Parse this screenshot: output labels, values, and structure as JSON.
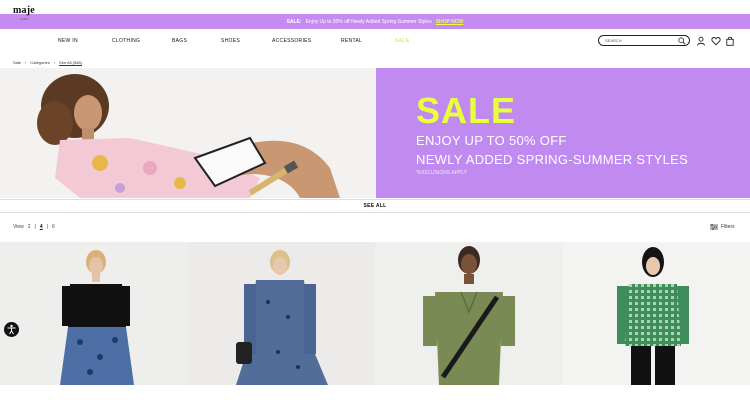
{
  "promo": {
    "sale": "SALE:",
    "text": "Enjoy Up to 50% off Newly Added Spring-Summer Styles",
    "link": "SHOP NOW"
  },
  "header": {
    "logo": "maje",
    "logo_sub": "PARIS",
    "nav": [
      "NEW IN",
      "CLOTHING",
      "BAGS",
      "SHOES",
      "ACCESSORIES",
      "RENTAL",
      "SALE"
    ],
    "search_placeholder": "SEARCH"
  },
  "breadcrumb": [
    "Sale",
    "Categories",
    "See All (548)"
  ],
  "hero": {
    "sale": "SALE",
    "line1": "ENJOY UP TO 50% OFF",
    "line2": "NEWLY ADDED SPRING-SUMMER STYLES",
    "note": "*EXCLUSIONS APPLY"
  },
  "see_all": "SEE ALL",
  "view": {
    "label": "View",
    "options": [
      "2",
      "4",
      "6"
    ],
    "selected": "4"
  },
  "filters_label": "Filters",
  "colors": {
    "promo_bg": "#c68bf0",
    "hero_panel": "#c08af0",
    "accent_lime": "#e9ff3b"
  }
}
